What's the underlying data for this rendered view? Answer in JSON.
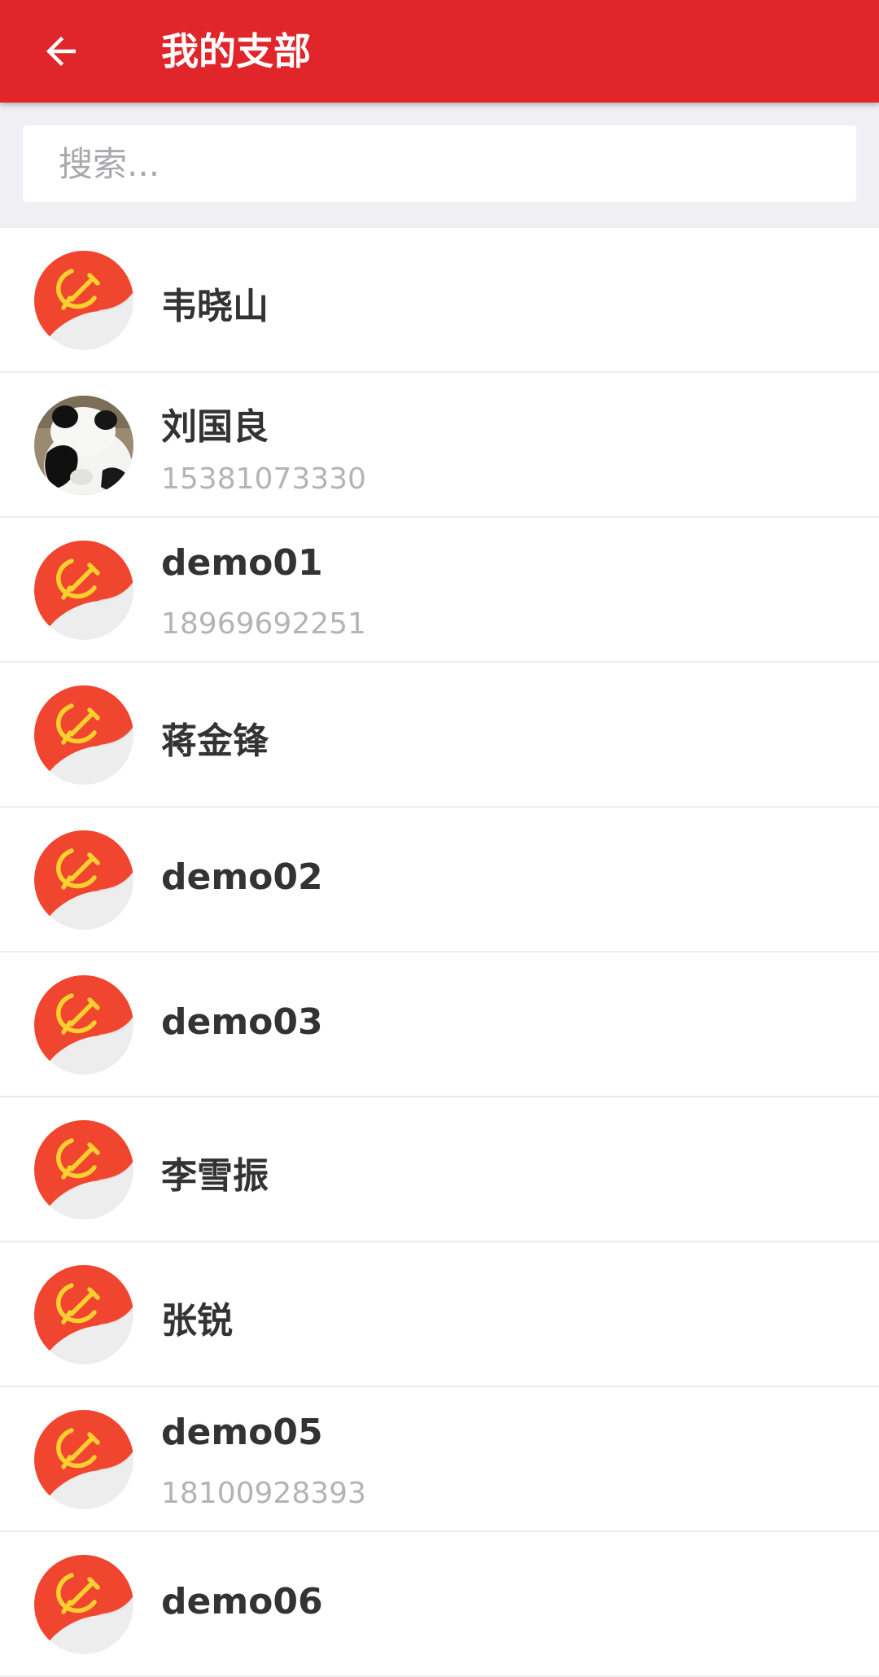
{
  "header": {
    "title": "我的支部",
    "back_icon": "arrow-left-icon",
    "bar_color": "#e0262a"
  },
  "search": {
    "placeholder": "搜索...",
    "value": ""
  },
  "members": [
    {
      "name": "韦晓山",
      "phone": "",
      "avatar": "party-flag-icon"
    },
    {
      "name": "刘国良",
      "phone": "15381073330",
      "avatar": "panda-photo"
    },
    {
      "name": "demo01",
      "phone": "18969692251",
      "avatar": "party-flag-icon"
    },
    {
      "name": "蒋金锋",
      "phone": "",
      "avatar": "party-flag-icon"
    },
    {
      "name": "demo02",
      "phone": "",
      "avatar": "party-flag-icon"
    },
    {
      "name": "demo03",
      "phone": "",
      "avatar": "party-flag-icon"
    },
    {
      "name": "李雪振",
      "phone": "",
      "avatar": "party-flag-icon"
    },
    {
      "name": "张锐",
      "phone": "",
      "avatar": "party-flag-icon"
    },
    {
      "name": "demo05",
      "phone": "18100928393",
      "avatar": "party-flag-icon"
    },
    {
      "name": "demo06",
      "phone": "",
      "avatar": "party-flag-icon"
    }
  ]
}
